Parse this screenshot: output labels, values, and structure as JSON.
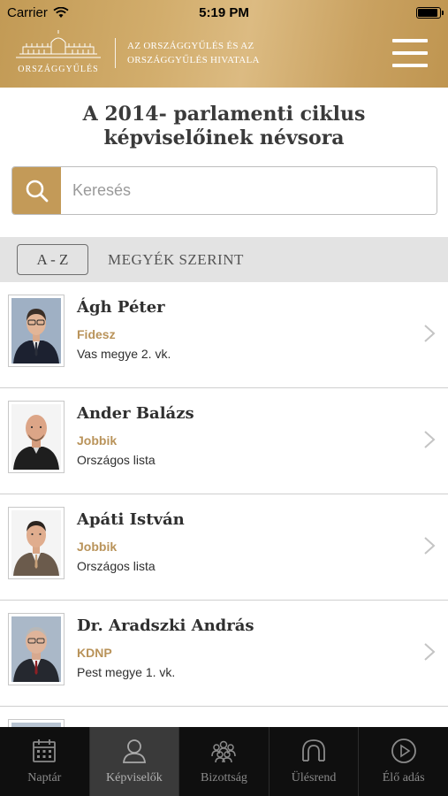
{
  "status_bar": {
    "carrier": "Carrier",
    "time": "5:19 PM"
  },
  "header": {
    "logo_text": "ORSZÁGGYŰLÉS",
    "org_line1": "AZ ORSZÁGGYŰLÉS ÉS AZ",
    "org_line2": "ORSZÁGGYŰLÉS HIVATALA",
    "menu_icon": "hamburger-menu-icon"
  },
  "page": {
    "title": "A 2014- parlamenti ciklus képviselőinek névsora"
  },
  "search": {
    "placeholder": "Keresés",
    "value": "",
    "icon": "search-icon"
  },
  "filters": {
    "az_label": "A - Z",
    "county_label": "MEGYÉK SZERINT"
  },
  "members": [
    {
      "name": "Ágh Péter",
      "party": "Fidesz",
      "district": "Vas megye 2. vk."
    },
    {
      "name": "Ander Balázs",
      "party": "Jobbik",
      "district": "Országos lista"
    },
    {
      "name": "Apáti István",
      "party": "Jobbik",
      "district": "Országos lista"
    },
    {
      "name": "Dr. Aradszki András",
      "party": "KDNP",
      "district": "Pest megye 1. vk."
    }
  ],
  "tabs": [
    {
      "label": "Naptár",
      "icon": "calendar-icon"
    },
    {
      "label": "Képviselők",
      "icon": "person-icon",
      "active": true
    },
    {
      "label": "Bizottság",
      "icon": "group-icon"
    },
    {
      "label": "Ülésrend",
      "icon": "seating-icon"
    },
    {
      "label": "Élő adás",
      "icon": "play-icon"
    }
  ],
  "colors": {
    "accent": "#c39a58",
    "party": "#b9935a",
    "tabbar": "#0f0f0f"
  }
}
